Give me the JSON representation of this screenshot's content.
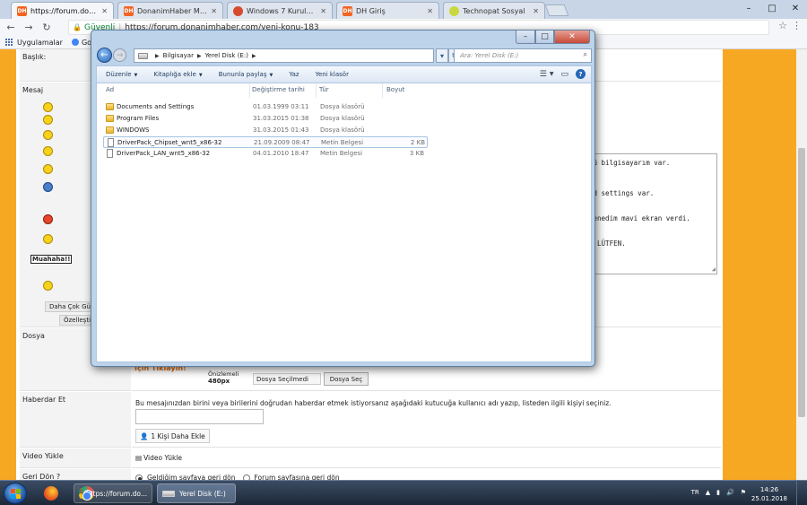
{
  "browser": {
    "tabs": [
      {
        "label": "https://forum.donanimhab...",
        "favicon": "DH",
        "color": "#f26522",
        "active": true
      },
      {
        "label": "DonanimHaber Mobil",
        "favicon": "DH",
        "color": "#f26522"
      },
      {
        "label": "Windows 7 Kurulu Bir Se...",
        "favicon": "",
        "color": "#d64a2e"
      },
      {
        "label": "DH Giriş",
        "favicon": "DH",
        "color": "#f26522"
      },
      {
        "label": "Technopat Sosyal",
        "favicon": "",
        "color": "#c9d840"
      }
    ],
    "window_controls": {
      "minimize": "–",
      "maximize": "□",
      "close": "✕"
    },
    "secure_label": "Güvenli",
    "url": "https://forum.donanimhaber.com/yeni-konu-183",
    "bookmarks": [
      {
        "label": "Uygulamalar"
      },
      {
        "label": "Goo"
      }
    ]
  },
  "form": {
    "labels": {
      "title": "Başlık:",
      "message": "Mesaj",
      "file": "Dosya",
      "notify": "Haberdar Et",
      "video": "Video Yükle",
      "return": "Geri Dön ?"
    },
    "smiley_muahaha": "Muahaha!!",
    "more_smileys": "Daha Çok Gül",
    "customize": "Özelleştir",
    "textarea_lines": [
      "tü bilgisayarım var.",
      "nd settings var.",
      "denedim mavi ekran verdi.",
      "M LÜTFEN."
    ],
    "upload_banner": "İçin Tıklayın!",
    "preview_label": "Önizlemeli",
    "preview_size": "480px",
    "file_status": "Dosya Seçilmedi",
    "file_button": "Dosya Seç",
    "notify_text": "Bu mesajınızdan birini veya birilerini doğrudan haberdar etmek istiyorsanız aşağıdaki kutucuğa kullanıcı adı yazıp, listeden ilgili kişiyi seçiniz.",
    "add_person": "1 Kişi Daha Ekle",
    "video_link": "Video Yükle",
    "return_options": [
      {
        "label": "Geldiğim sayfaya geri dön",
        "selected": true
      },
      {
        "label": "Forum sayfasına geri dön",
        "selected": false
      }
    ]
  },
  "explorer": {
    "breadcrumb": [
      "Bilgisayar",
      "Yerel Disk (E:)"
    ],
    "search_placeholder": "Ara: Yerel Disk (E:)",
    "commands": [
      "Düzenle",
      "Kitaplığa ekle",
      "Bununla paylaş",
      "Yaz",
      "Yeni klasör"
    ],
    "columns": {
      "name": "Ad",
      "date": "Değiştirme tarihi",
      "type": "Tür",
      "size": "Boyut"
    },
    "rows": [
      {
        "name": "Documents and Settings",
        "date": "01.03.1999 03:11",
        "type": "Dosya klasörü",
        "size": "",
        "kind": "folder"
      },
      {
        "name": "Program Files",
        "date": "31.03.2015 01:38",
        "type": "Dosya klasörü",
        "size": "",
        "kind": "folder"
      },
      {
        "name": "WINDOWS",
        "date": "31.03.2015 01:43",
        "type": "Dosya klasörü",
        "size": "",
        "kind": "folder"
      },
      {
        "name": "DriverPack_Chipset_wnt5_x86-32",
        "date": "21.09.2009 08:47",
        "type": "Metin Belgesi",
        "size": "2 KB",
        "kind": "file",
        "selected": true
      },
      {
        "name": "DriverPack_LAN_wnt5_x86-32",
        "date": "04.01.2010 18:47",
        "type": "Metin Belgesi",
        "size": "3 KB",
        "kind": "file"
      }
    ]
  },
  "taskbar": {
    "tasks": [
      {
        "label": "https://forum.do..."
      },
      {
        "label": "Yerel Disk (E:)"
      }
    ],
    "language": "TR",
    "time": "14:26",
    "date": "25.01.2018"
  }
}
